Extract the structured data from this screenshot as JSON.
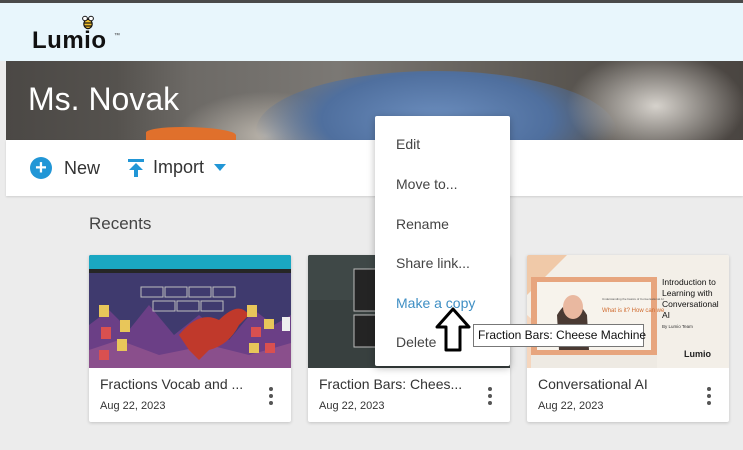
{
  "app": {
    "logo_text": "Lumio",
    "logo_tm": "™"
  },
  "banner": {
    "title": "Ms. Novak"
  },
  "toolbar": {
    "new_label": "New",
    "import_label": "Import"
  },
  "recents": {
    "heading": "Recents",
    "cards": [
      {
        "title": "Fractions Vocab and ...",
        "date": "Aug 22, 2023"
      },
      {
        "title": "Fraction Bars: Chees...",
        "date": "Aug 22, 2023"
      },
      {
        "title": "Conversational AI",
        "date": "Aug 22, 2023"
      }
    ]
  },
  "thumb3": {
    "heading": "Introduction to Learning with Conversational AI",
    "byline": "By Lumio Team",
    "logo": "Lumio",
    "inner_small": "Understanding the basics of Conversational AI",
    "inner_question": "What is it? How can we"
  },
  "context_menu": {
    "items": [
      "Edit",
      "Move to...",
      "Rename",
      "Share link...",
      "Make a copy",
      "Delete"
    ]
  },
  "tooltip": {
    "text": "Fraction Bars: Cheese Machine"
  },
  "colors": {
    "accent": "#2196d6",
    "menu_active": "#3f8fc4",
    "topbar": "#e8f6fc"
  },
  "icons": {
    "new": "plus-circle-icon",
    "import": "upload-icon",
    "more": "more-vertical-icon",
    "cursor": "arrow-up-cursor-icon"
  }
}
